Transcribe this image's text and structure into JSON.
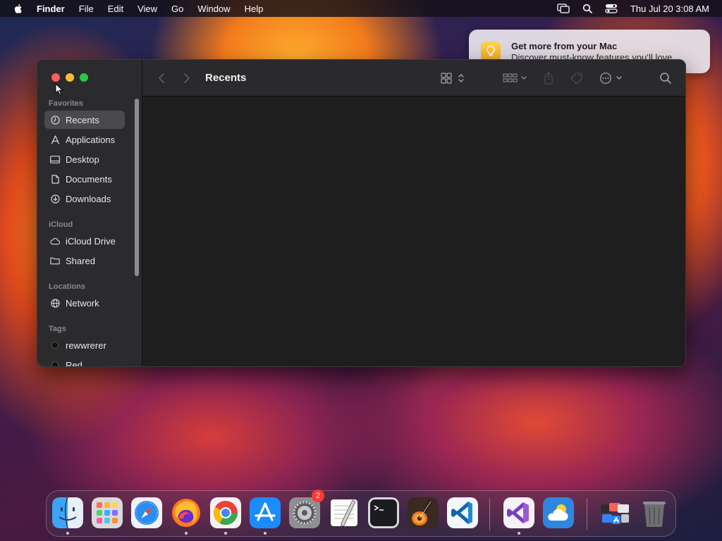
{
  "menubar": {
    "app_name": "Finder",
    "menus": [
      "File",
      "Edit",
      "View",
      "Go",
      "Window",
      "Help"
    ],
    "clock": "Thu Jul 20  3:08 AM"
  },
  "notification": {
    "title": "Get more from your Mac",
    "body": "Discover must-know features you’ll love."
  },
  "finder": {
    "title": "Recents",
    "sidebar": {
      "favorites_title": "Favorites",
      "favorites": [
        {
          "label": "Recents",
          "icon": "clock-icon",
          "selected": true
        },
        {
          "label": "Applications",
          "icon": "applications-icon"
        },
        {
          "label": "Desktop",
          "icon": "desktop-icon"
        },
        {
          "label": "Documents",
          "icon": "document-icon"
        },
        {
          "label": "Downloads",
          "icon": "download-icon"
        }
      ],
      "icloud_title": "iCloud",
      "icloud": [
        {
          "label": "iCloud Drive",
          "icon": "cloud-icon"
        },
        {
          "label": "Shared",
          "icon": "shared-folder-icon"
        }
      ],
      "locations_title": "Locations",
      "locations": [
        {
          "label": "Network",
          "icon": "globe-icon"
        }
      ],
      "tags_title": "Tags",
      "tags": [
        {
          "label": "rewwrerer",
          "color": "#111111"
        },
        {
          "label": "Red",
          "color": "#111111"
        }
      ]
    }
  },
  "dock": {
    "apps": [
      {
        "name": "Finder",
        "icon": "finder-icon"
      },
      {
        "name": "Launchpad",
        "icon": "launchpad-icon"
      },
      {
        "name": "Safari",
        "icon": "safari-icon"
      },
      {
        "name": "Firefox",
        "icon": "firefox-icon"
      },
      {
        "name": "Chrome",
        "icon": "chrome-icon"
      },
      {
        "name": "App Store",
        "icon": "app-store-icon"
      },
      {
        "name": "System Settings",
        "icon": "settings-icon",
        "badge": "2"
      },
      {
        "name": "TextEdit",
        "icon": "textedit-icon"
      },
      {
        "name": "Terminal",
        "icon": "terminal-icon"
      },
      {
        "name": "GarageBand",
        "icon": "garageband-icon"
      },
      {
        "name": "Visual Studio Code",
        "icon": "vscode-icon"
      },
      {
        "name": "Visual Studio",
        "icon": "visual-studio-icon"
      },
      {
        "name": "Weather",
        "icon": "weather-icon"
      },
      {
        "name": "Applications Stack",
        "icon": "stack-icon"
      },
      {
        "name": "Trash",
        "icon": "trash-icon"
      }
    ]
  },
  "colors": {
    "close": "#ff5f57",
    "minimize": "#febc2e",
    "maximize": "#28c840",
    "badge": "#ff3b30"
  }
}
